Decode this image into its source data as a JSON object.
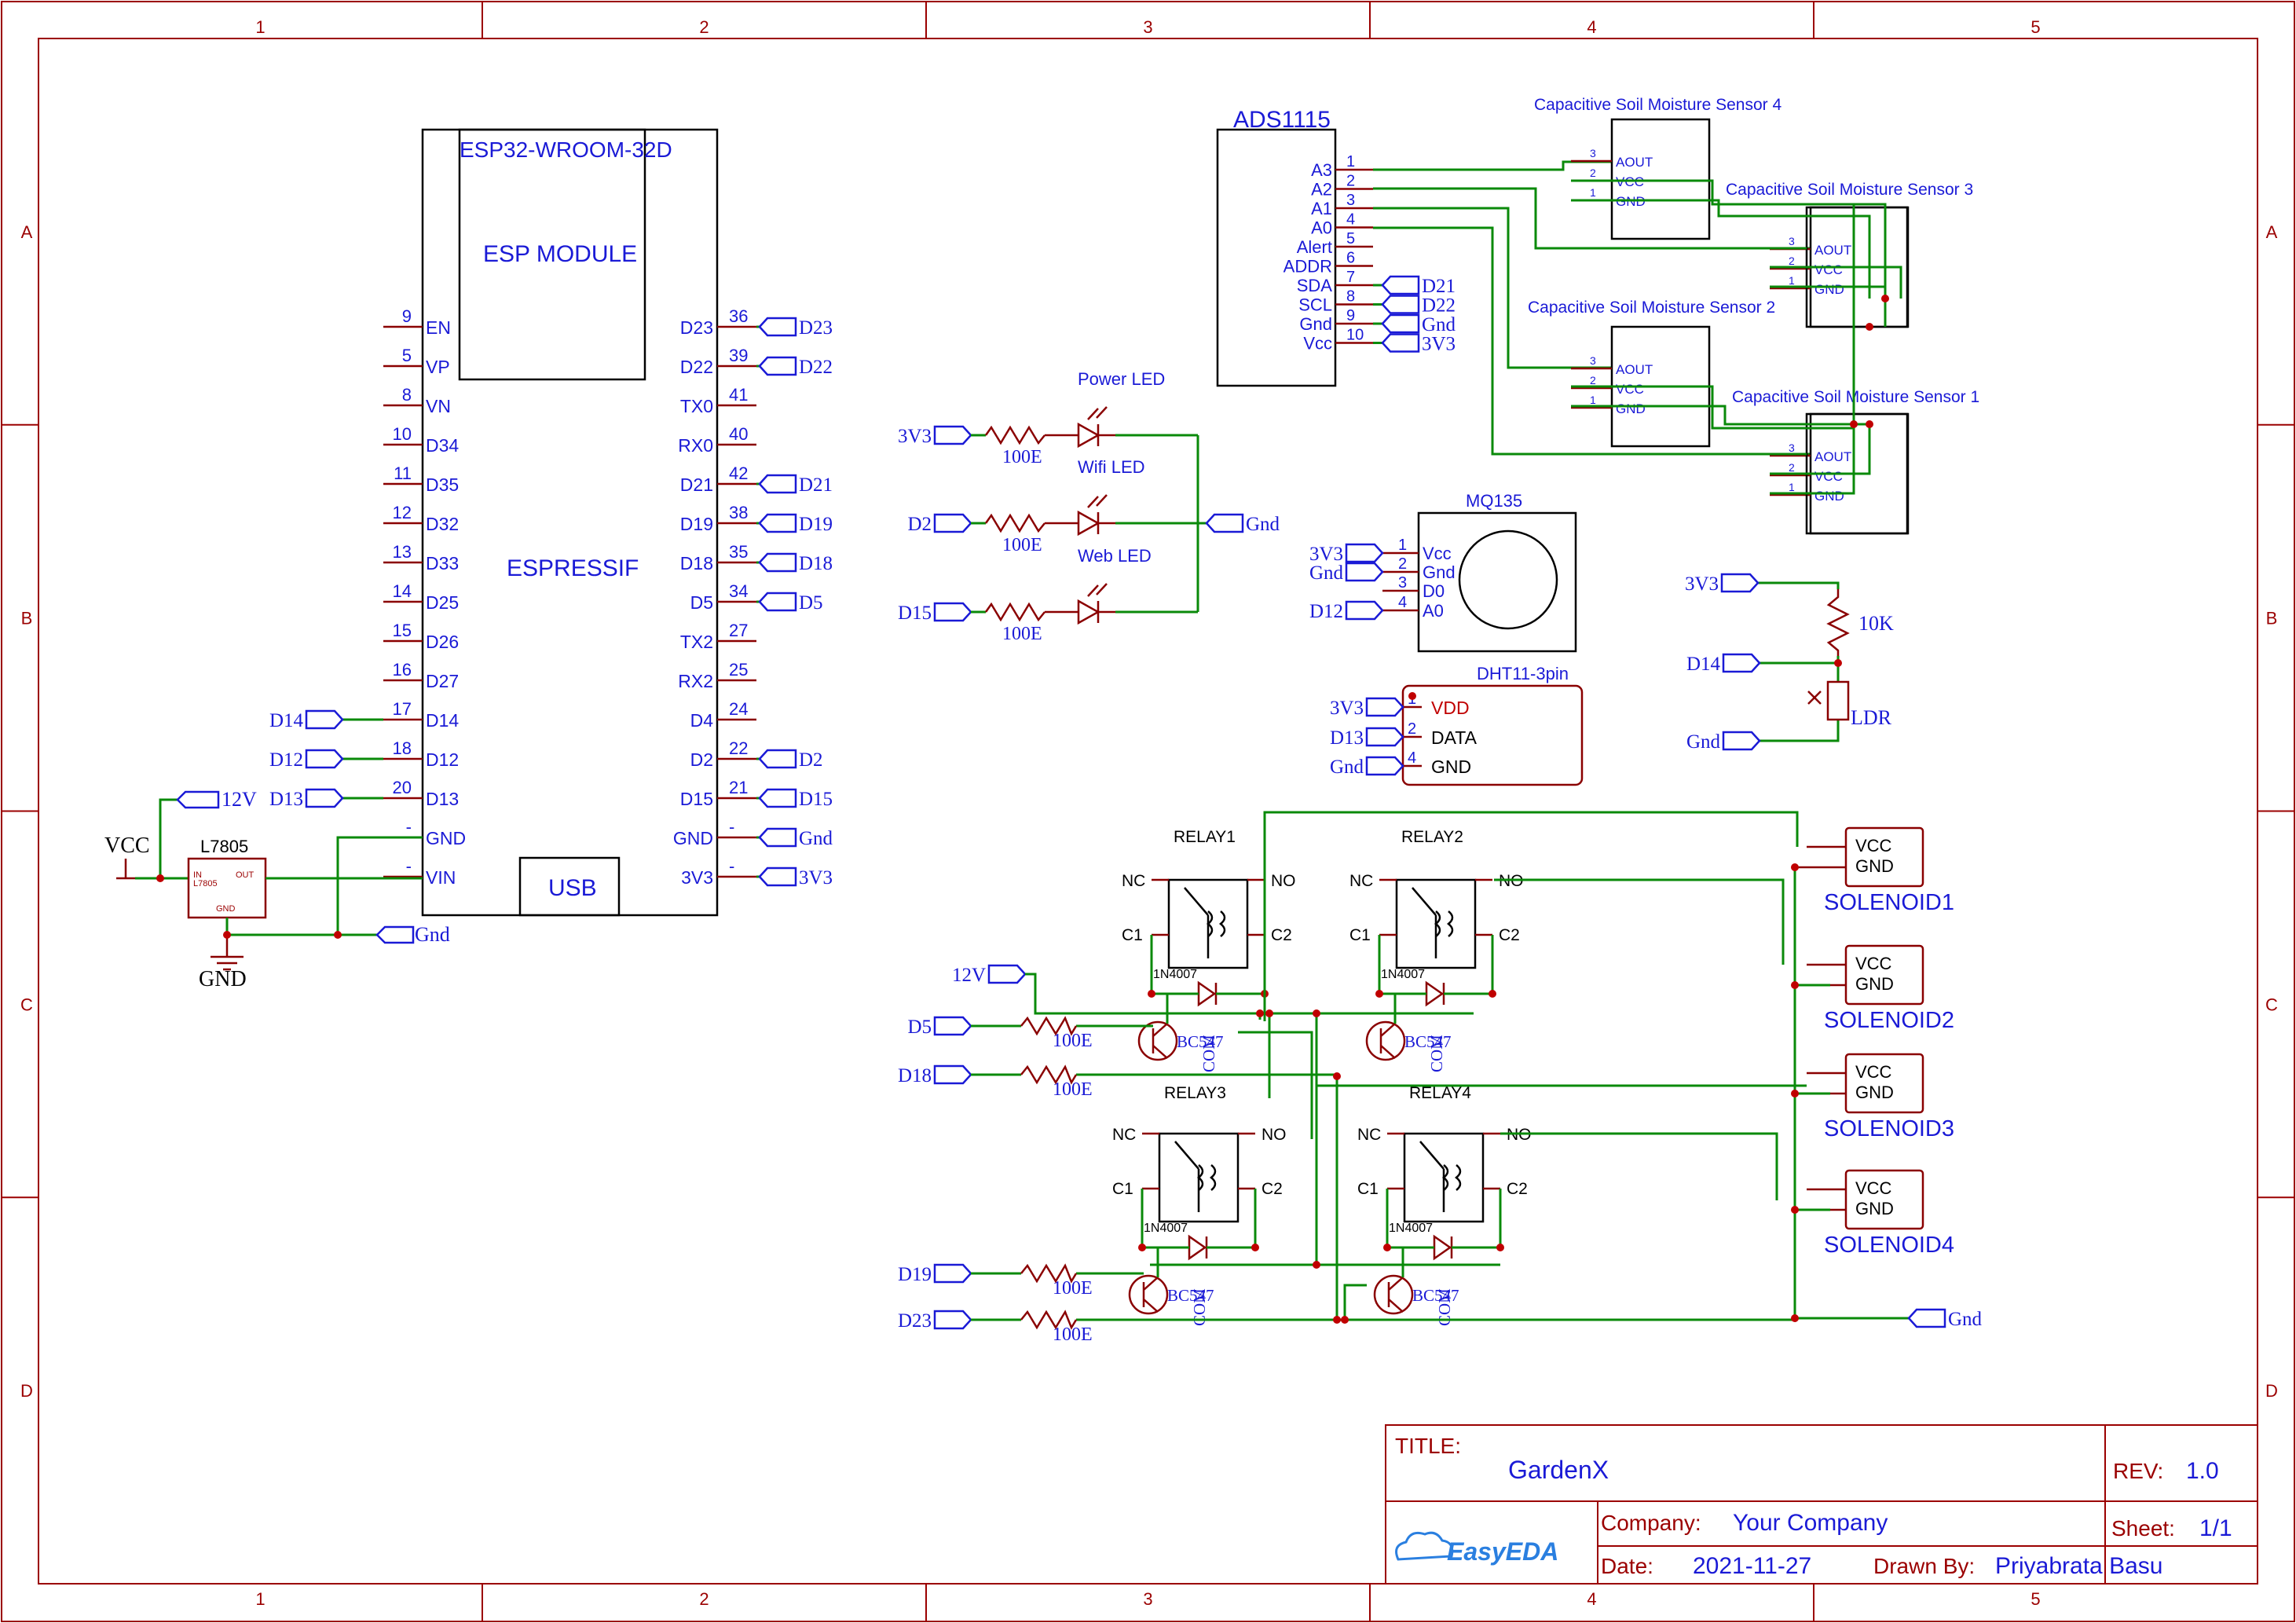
{
  "frame": {
    "columns": [
      "1",
      "2",
      "3",
      "4",
      "5"
    ],
    "rows": [
      "A",
      "B",
      "C",
      "D"
    ]
  },
  "title_block": {
    "title_label": "TITLE:",
    "title": "GardenX",
    "rev_label": "REV:",
    "rev": "1.0",
    "company_label": "Company:",
    "company": "Your Company",
    "sheet_label": "Sheet:",
    "sheet": "1/1",
    "date_label": "Date:",
    "date": "2021-11-27",
    "drawn_label": "Drawn By:",
    "drawn_by": "Priyabrata Basu",
    "logo": "EasyEDA"
  },
  "esp32": {
    "name": "ESP32-WROOM-32D",
    "module": "ESP MODULE",
    "vendor": "ESPRESSIF",
    "usb": "USB",
    "left_pins": [
      {
        "num": "9",
        "name": "EN"
      },
      {
        "num": "5",
        "name": "VP"
      },
      {
        "num": "8",
        "name": "VN"
      },
      {
        "num": "10",
        "name": "D34"
      },
      {
        "num": "11",
        "name": "D35"
      },
      {
        "num": "12",
        "name": "D32"
      },
      {
        "num": "13",
        "name": "D33"
      },
      {
        "num": "14",
        "name": "D25"
      },
      {
        "num": "15",
        "name": "D26"
      },
      {
        "num": "16",
        "name": "D27"
      },
      {
        "num": "17",
        "name": "D14"
      },
      {
        "num": "18",
        "name": "D12"
      },
      {
        "num": "20",
        "name": "D13"
      },
      {
        "num": "-",
        "name": "GND"
      },
      {
        "num": "-",
        "name": "VIN"
      }
    ],
    "right_pins": [
      {
        "num": "36",
        "name": "D23"
      },
      {
        "num": "39",
        "name": "D22"
      },
      {
        "num": "41",
        "name": "TX0"
      },
      {
        "num": "40",
        "name": "RX0"
      },
      {
        "num": "42",
        "name": "D21"
      },
      {
        "num": "38",
        "name": "D19"
      },
      {
        "num": "35",
        "name": "D18"
      },
      {
        "num": "34",
        "name": "D5"
      },
      {
        "num": "27",
        "name": "TX2"
      },
      {
        "num": "25",
        "name": "RX2"
      },
      {
        "num": "24",
        "name": "D4"
      },
      {
        "num": "22",
        "name": "D2"
      },
      {
        "num": "21",
        "name": "D15"
      },
      {
        "num": "-",
        "name": "GND"
      },
      {
        "num": "-",
        "name": "3V3"
      }
    ],
    "left_nets": [
      "D14",
      "D12",
      "D13"
    ],
    "right_nets": [
      "D23",
      "D22",
      "",
      "",
      "D21",
      "D19",
      "D18",
      "D5",
      "",
      "",
      "",
      "D2",
      "D15",
      "Gnd",
      "3V3"
    ]
  },
  "power": {
    "vcc": "VCC",
    "regulator": "L7805",
    "reg_in": "IN",
    "reg_out": "OUT",
    "reg_gnd": "GND",
    "reg_label": "L7805",
    "net_12v": "12V",
    "ground": "GND",
    "gnd_net": "Gnd"
  },
  "ads1115": {
    "name": "ADS1115",
    "pins": [
      {
        "num": "1",
        "name": "A3"
      },
      {
        "num": "2",
        "name": "A2"
      },
      {
        "num": "3",
        "name": "A1"
      },
      {
        "num": "4",
        "name": "A0"
      },
      {
        "num": "5",
        "name": "Alert"
      },
      {
        "num": "6",
        "name": "ADDR"
      },
      {
        "num": "7",
        "name": "SDA"
      },
      {
        "num": "8",
        "name": "SCL"
      },
      {
        "num": "9",
        "name": "Gnd"
      },
      {
        "num": "10",
        "name": "Vcc"
      }
    ],
    "nets": [
      "D21",
      "D22",
      "Gnd",
      "3V3"
    ]
  },
  "sensors": [
    {
      "title": "Capacitive Soil Moisture Sensor 4",
      "pins": [
        "AOUT",
        "VCC",
        "GND"
      ],
      "nums": [
        "3",
        "2",
        "1"
      ]
    },
    {
      "title": "Capacitive Soil Moisture Sensor 3",
      "pins": [
        "AOUT",
        "VCC",
        "GND"
      ],
      "nums": [
        "3",
        "2",
        "1"
      ]
    },
    {
      "title": "Capacitive Soil Moisture Sensor 2",
      "pins": [
        "AOUT",
        "VCC",
        "GND"
      ],
      "nums": [
        "3",
        "2",
        "1"
      ]
    },
    {
      "title": "Capacitive Soil Moisture Sensor 1",
      "pins": [
        "AOUT",
        "VCC",
        "GND"
      ],
      "nums": [
        "3",
        "2",
        "1"
      ]
    }
  ],
  "leds": [
    {
      "net": "3V3",
      "res": "100E",
      "title": "Power LED"
    },
    {
      "net": "D2",
      "res": "100E",
      "title": "Wifi LED"
    },
    {
      "net": "D15",
      "res": "100E",
      "title": "Web LED"
    }
  ],
  "led_gnd": "Gnd",
  "mq135": {
    "name": "MQ135",
    "pins": [
      {
        "num": "1",
        "name": "Vcc"
      },
      {
        "num": "2",
        "name": "Gnd"
      },
      {
        "num": "3",
        "name": "D0"
      },
      {
        "num": "4",
        "name": "A0"
      }
    ],
    "nets": [
      "3V3",
      "Gnd",
      "D12"
    ]
  },
  "dht11": {
    "name": "DHT11-3pin",
    "pins": [
      {
        "num": "1",
        "name": "VDD"
      },
      {
        "num": "2",
        "name": "DATA"
      },
      {
        "num": "4",
        "name": "GND"
      }
    ],
    "nets": [
      "3V3",
      "D13",
      "Gnd"
    ]
  },
  "ldr": {
    "nets": [
      "3V3",
      "D14",
      "Gnd"
    ],
    "res": "10K",
    "name": "LDR"
  },
  "relays": [
    {
      "name": "RELAY1",
      "nc": "NC",
      "no": "NO",
      "c1": "C1",
      "c2": "C2",
      "diode": "1N4007",
      "com": "COM",
      "transistor": "BC547",
      "net": "D5",
      "res": "100E"
    },
    {
      "name": "RELAY2",
      "nc": "NC",
      "no": "NO",
      "c1": "C1",
      "c2": "C2",
      "diode": "1N4007",
      "com": "COM",
      "transistor": "BC547",
      "net": "D18",
      "res": "100E"
    },
    {
      "name": "RELAY3",
      "nc": "NC",
      "no": "NO",
      "c1": "C1",
      "c2": "C2",
      "diode": "1N4007",
      "com": "COM",
      "transistor": "BC547",
      "net": "D19",
      "res": "100E"
    },
    {
      "name": "RELAY4",
      "nc": "NC",
      "no": "NO",
      "c1": "C1",
      "c2": "C2",
      "diode": "1N4007",
      "com": "COM",
      "transistor": "BC547",
      "net": "D23",
      "res": "100E"
    }
  ],
  "relay_12v": "12V",
  "solenoids": [
    {
      "name": "SOLENOID1",
      "vcc": "VCC",
      "gnd": "GND"
    },
    {
      "name": "SOLENOID2",
      "vcc": "VCC",
      "gnd": "GND"
    },
    {
      "name": "SOLENOID3",
      "vcc": "VCC",
      "gnd": "GND"
    },
    {
      "name": "SOLENOID4",
      "vcc": "VCC",
      "gnd": "GND"
    }
  ],
  "solenoid_gnd": "Gnd"
}
